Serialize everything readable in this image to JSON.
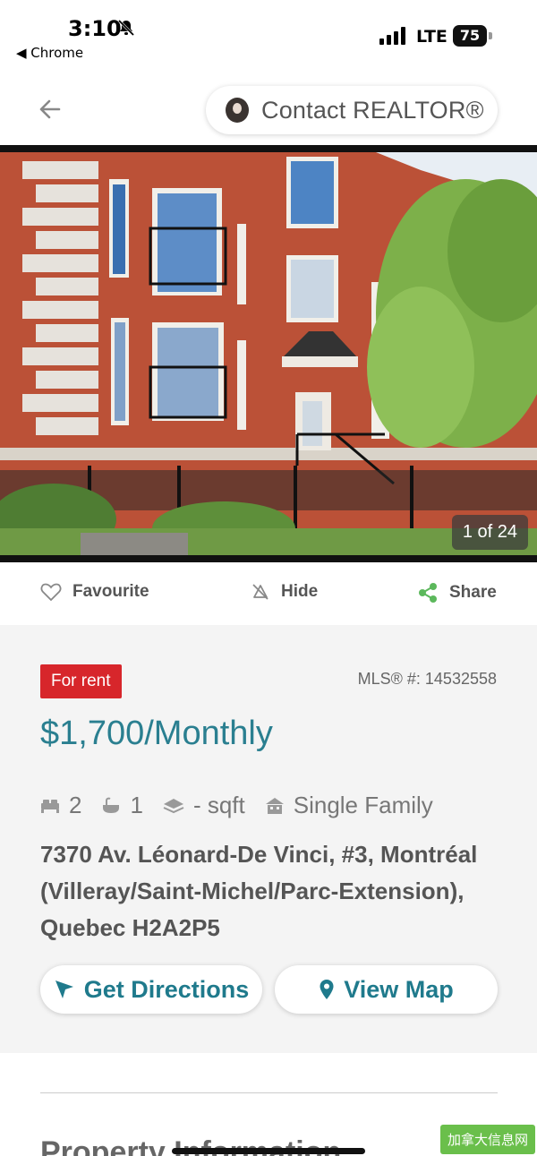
{
  "status_bar": {
    "time": "3:10",
    "back_app": "◀ Chrome",
    "network": "LTE",
    "battery": "75"
  },
  "header": {
    "contact_button": "Contact REALTOR®"
  },
  "photo": {
    "counter": "1 of 24"
  },
  "actions": {
    "favourite": "Favourite",
    "hide": "Hide",
    "share": "Share"
  },
  "listing": {
    "badge": "For rent",
    "mls": "MLS® #: 14532558",
    "price": "$1,700/Monthly",
    "bedrooms": "2",
    "bathrooms": "1",
    "sqft": "- sqft",
    "type": "Single Family",
    "address": "7370 Av. Léonard-De Vinci, #3, Montréal (Villeray/Saint-Michel/Parc-Extension), Quebec H2A2P5"
  },
  "buttons": {
    "directions": "Get Directions",
    "view_map": "View Map"
  },
  "section": {
    "title": "Property Information"
  },
  "watermark": "加拿大信息网",
  "colors": {
    "accent": "#1f7a8c",
    "price": "#2a7f90",
    "rent_badge": "#d7262b",
    "share_icon": "#5cb85c"
  }
}
